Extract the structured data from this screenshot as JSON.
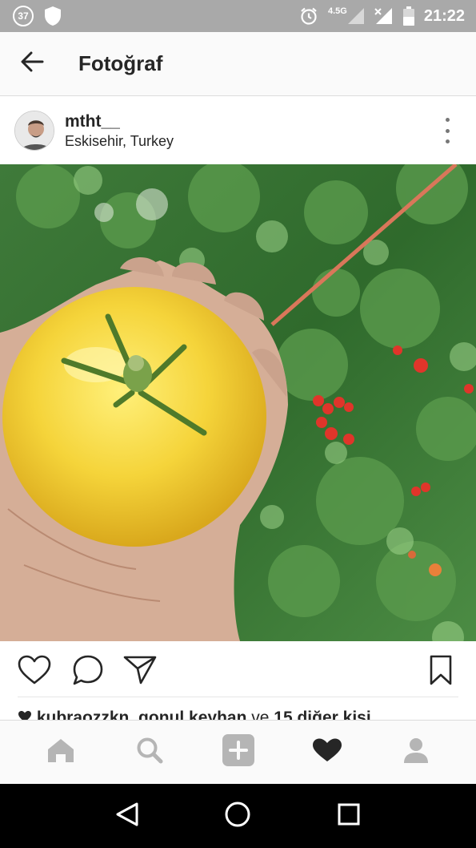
{
  "status_bar": {
    "notification_count": "37",
    "network_type": "4.5G",
    "time": "21:22",
    "icons": [
      "shield-icon",
      "alarm-icon",
      "signal-icon",
      "no-signal-icon",
      "battery-icon"
    ]
  },
  "app_bar": {
    "title": "Fotoğraf",
    "back_icon": "arrow-left-icon"
  },
  "post": {
    "username": "mtht__",
    "location": "Eskisehir, Turkey",
    "photo_description_icon": "photo",
    "likes": {
      "user1": "kubraozzkn",
      "user2": "gonul.keyhan",
      "connector": "ve",
      "others": "15 diğer kişi"
    }
  },
  "actions": {
    "like_icon": "heart-outline-icon",
    "comment_icon": "comment-icon",
    "share_icon": "send-icon",
    "save_icon": "bookmark-icon"
  },
  "bottom_nav": {
    "items": [
      "home-icon",
      "search-icon",
      "add-icon",
      "activity-heart-icon",
      "profile-icon"
    ],
    "active": "activity-heart-icon"
  },
  "system_nav": {
    "items": [
      "back-triangle-icon",
      "home-circle-icon",
      "recents-square-icon"
    ]
  },
  "colors": {
    "status_bar_bg": "#a9a9a9",
    "app_bar_bg": "#fafafa",
    "text_primary": "#262626",
    "icon_inactive": "#b5b5b5",
    "icon_active": "#262626"
  }
}
